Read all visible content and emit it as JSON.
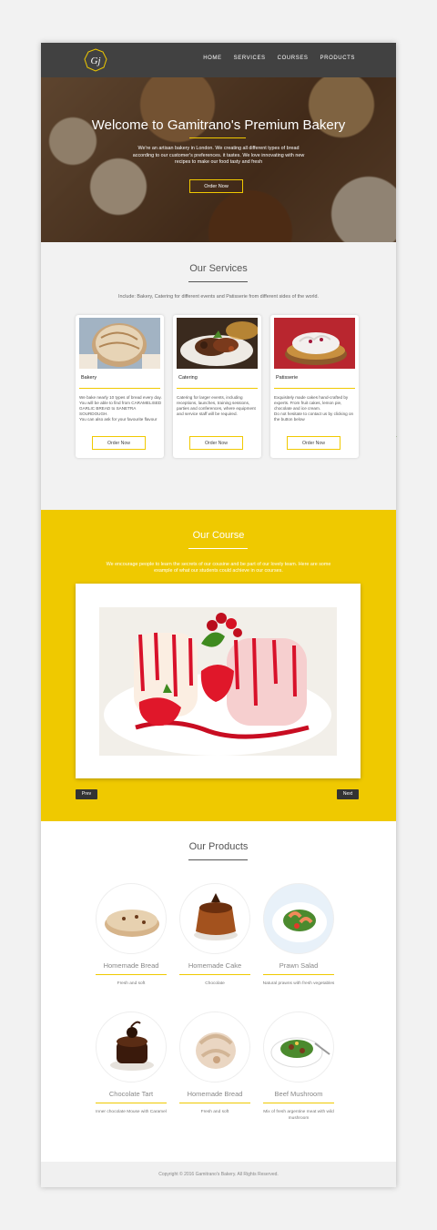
{
  "nav": {
    "logo_text": "Gj",
    "links": [
      "HOME",
      "SERVICES",
      "COURSES",
      "PRODUCTS"
    ]
  },
  "hero": {
    "title": "Welcome to Gamitrano's Premium Bakery",
    "description": "We're an artisan bakery in London. We creating all different types of bread according to our customer's preferences. it tastes. We love innovating with new recipes to make our food tasty and fresh",
    "button": "Order Now"
  },
  "services": {
    "title": "Our Services",
    "subtitle": "Include: Bakery, Catering for different events and Patisserie from different sides of the world.",
    "cards": [
      {
        "name": "Bakery",
        "description": "We bake nearly 10 types of bread every day. You will be able to find from CARAMELISED GARLIC BREAD to SANETRA SOURDOUGH.\nYou can also ask for your favourite flavour",
        "button": "Order Now"
      },
      {
        "name": "Catering",
        "description": "Catering for larger events, including receptions, launches, training sessions, parties and conferences, where equipment and service staff will be required.",
        "button": "Order Now"
      },
      {
        "name": "Patisserie",
        "description": "Exquisitely made cakes hand-crafted by experts. From fruit cakes, lemon pie, chocolate and ice cream.\nDo not hesitate to contact us by clicking on the button below",
        "button": "Order Now"
      }
    ]
  },
  "course": {
    "title": "Our Course",
    "description": "We encourage people to learn the secrets of our cousine and be part of our lovely team. Here are some example of what our students could achieve in our courses.",
    "prev": "Prev",
    "next": "Next"
  },
  "products": {
    "title": "Our Products",
    "items": [
      {
        "name": "Homemade Bread",
        "description": "Fresh and soft"
      },
      {
        "name": "Homemade Cake",
        "description": "Chocolate"
      },
      {
        "name": "Prawn Salad",
        "description": "Natural prawns with fresh vegetables"
      },
      {
        "name": "Chocolate Tart",
        "description": "Inner chocolate Mouse with Caramel"
      },
      {
        "name": "Homemade Bread",
        "description": "Fresh and soft"
      },
      {
        "name": "Beef Mushroom",
        "description": "Mix of fresh argentine meat with wild mushroom"
      }
    ]
  },
  "footer": {
    "copyright": "Copyright © 2016 Gamitrano's Bakery. All Rights Reserved."
  },
  "colors": {
    "accent": "#efc900",
    "nav": "#414141",
    "section_bg": "#f2f2f2"
  }
}
